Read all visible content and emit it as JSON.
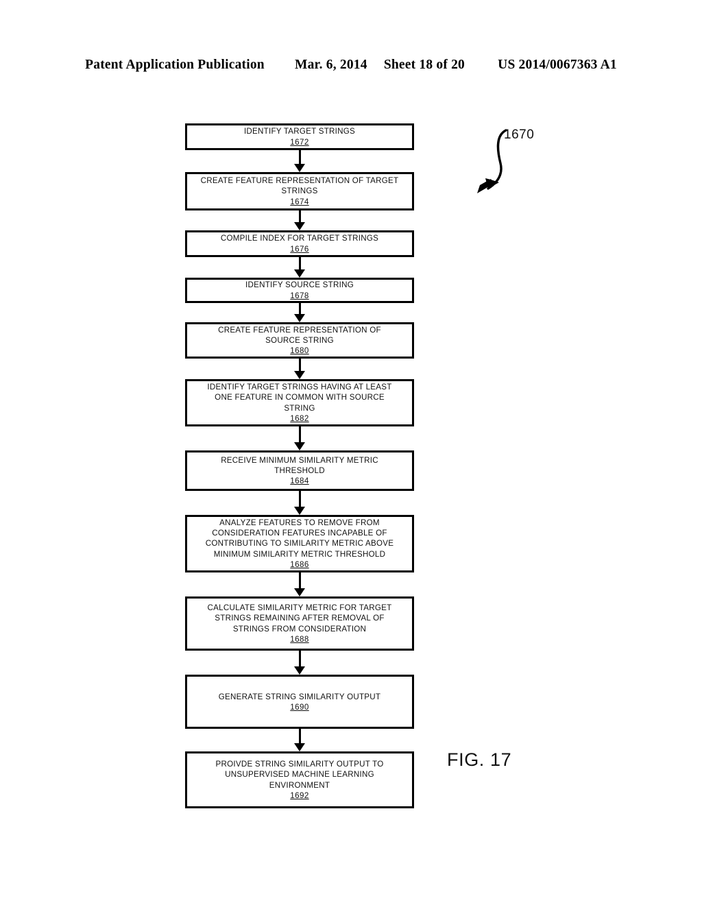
{
  "header": {
    "publication": "Patent Application Publication",
    "date": "Mar. 6, 2014",
    "sheet": "Sheet 18 of 20",
    "patent_number": "US 2014/0067363 A1"
  },
  "figure": {
    "label": "FIG. 17",
    "callout_ref": "1670"
  },
  "flowchart": {
    "type": "flowchart",
    "orientation": "top-to-bottom",
    "nodes": [
      {
        "id": "n1",
        "text": "IDENTIFY TARGET STRINGS",
        "ref": "1672"
      },
      {
        "id": "n2",
        "text": "CREATE FEATURE REPRESENTATION OF TARGET\nSTRINGS",
        "ref": "1674"
      },
      {
        "id": "n3",
        "text": "COMPILE INDEX FOR TARGET STRINGS",
        "ref": "1676"
      },
      {
        "id": "n4",
        "text": "IDENTIFY SOURCE STRING",
        "ref": "1678"
      },
      {
        "id": "n5",
        "text": "CREATE FEATURE REPRESENTATION OF\nSOURCE STRING",
        "ref": "1680"
      },
      {
        "id": "n6",
        "text": "IDENTIFY TARGET STRINGS HAVING AT LEAST\nONE FEATURE IN COMMON WITH SOURCE\nSTRING",
        "ref": "1682"
      },
      {
        "id": "n7",
        "text": "RECEIVE MINIMUM SIMILARITY METRIC\nTHRESHOLD",
        "ref": "1684"
      },
      {
        "id": "n8",
        "text": "ANALYZE FEATURES TO REMOVE FROM\nCONSIDERATION FEATURES INCAPABLE OF\nCONTRIBUTING TO SIMILARITY METRIC ABOVE\nMINIMUM SIMILARITY METRIC THRESHOLD",
        "ref": "1686"
      },
      {
        "id": "n9",
        "text": "CALCULATE SIMILARITY METRIC FOR TARGET\nSTRINGS REMAINING AFTER REMOVAL OF\nSTRINGS FROM CONSIDERATION",
        "ref": "1688"
      },
      {
        "id": "n10",
        "text": "GENERATE STRING SIMILARITY OUTPUT",
        "ref": "1690"
      },
      {
        "id": "n11",
        "text": "PROIVDE STRING SIMILARITY OUTPUT TO\nUNSUPERVISED MACHINE LEARNING\nENVIRONMENT",
        "ref": "1692"
      }
    ],
    "edges": [
      {
        "from": "n1",
        "to": "n2"
      },
      {
        "from": "n2",
        "to": "n3"
      },
      {
        "from": "n3",
        "to": "n4"
      },
      {
        "from": "n4",
        "to": "n5"
      },
      {
        "from": "n5",
        "to": "n6"
      },
      {
        "from": "n6",
        "to": "n7"
      },
      {
        "from": "n7",
        "to": "n8"
      },
      {
        "from": "n8",
        "to": "n9"
      },
      {
        "from": "n9",
        "to": "n10"
      },
      {
        "from": "n10",
        "to": "n11"
      }
    ]
  },
  "colors": {
    "ink": "#000000",
    "paper": "#ffffff"
  }
}
